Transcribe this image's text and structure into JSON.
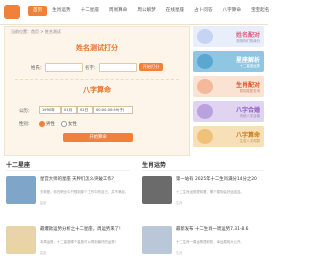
{
  "nav": {
    "items": [
      "首页",
      "生肖运势",
      "十二星座",
      "周易算命",
      "周公解梦",
      "在线星座",
      "占卜问答",
      "八字算命",
      "宝宝起名"
    ]
  },
  "breadcrumb": "当前位置：首页 > 姓名测试",
  "name_test": {
    "title": "姓名测试打分",
    "surname_label": "姓氏：",
    "given_label": "名字：",
    "submit_label": "开始打分"
  },
  "bazi": {
    "title": "八字算命",
    "birth_label": "公历：",
    "year": "1990年",
    "month": "01月",
    "day": "02日",
    "hour": "00:00-00:59(子)",
    "gender_label": "性别：",
    "male": "男性",
    "female": "女性",
    "submit_label": "开始算命"
  },
  "side_banners": [
    {
      "label": "姓名配对",
      "sub": "测测你们的缘分"
    },
    {
      "label": "星座解析",
      "sub": "十二星座运势"
    },
    {
      "label": "生肖配对",
      "sub": "属相婚配查询"
    },
    {
      "label": "八字合婚",
      "sub": "传统八字合婚"
    },
    {
      "label": "八字算命",
      "sub": "生辰八字测算"
    }
  ],
  "left_section": {
    "title": "十二星座",
    "articles": [
      {
        "title": "星宫大师的星座 天秤们怎么突破工作?",
        "text": "天秤座，你在职业中只想到那个工作中的自己，并不满足。",
        "meta": "星座"
      },
      {
        "title": "最爆款运势分析之十二星座，周运势来了!",
        "text": "本周运势，十二星座哪个星座可以得到最好的运势!",
        "meta": "星座"
      }
    ]
  },
  "right_section": {
    "title": "生肖运势",
    "articles": [
      {
        "title": "第一站有 2025年十二生肖满分14分之20",
        "text": "十二生肖运势提前看，哪个属相会好运连连。",
        "meta": "生肖"
      },
      {
        "title": "最新发布 十二生肖一周运势7.31-8.6",
        "text": "十二生肖一周运势提前知，幸运属相大公开。",
        "meta": "生肖"
      }
    ]
  },
  "colors": {
    "accent": "#f0803a",
    "panel": "#fdf5ea"
  }
}
